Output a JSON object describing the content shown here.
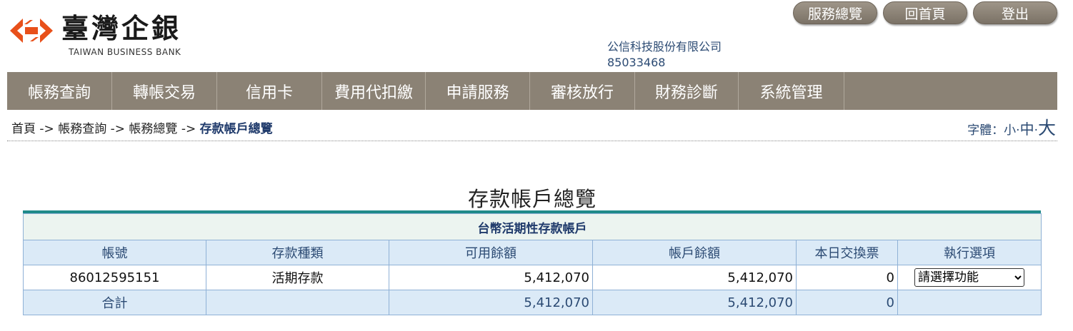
{
  "brand": {
    "name": "臺灣企銀",
    "subtitle": "TAIWAN BUSINESS BANK",
    "logo_color": "#e8501a"
  },
  "top_buttons": [
    "服務總覽",
    "回首頁",
    "登出"
  ],
  "company": {
    "name": "公信科技股份有限公司",
    "id": "85033468"
  },
  "menu": [
    "帳務查詢",
    "轉帳交易",
    "信用卡",
    "費用代扣繳",
    "申請服務",
    "審核放行",
    "財務診斷",
    "系統管理"
  ],
  "breadcrumb": {
    "items": [
      "首頁",
      "帳務查詢",
      "帳務總覽"
    ],
    "separator": "->",
    "current": "存款帳戶總覽"
  },
  "font_size": {
    "label": "字體：",
    "small": "小",
    "medium": "中",
    "large": "大",
    "dot": "·"
  },
  "page_title": "存款帳戶總覽",
  "table": {
    "section_title": "台幣活期性存款帳戶",
    "headers": [
      "帳號",
      "存款種類",
      "可用餘額",
      "帳戶餘額",
      "本日交換票",
      "執行選項"
    ],
    "row": {
      "account": "86012595151",
      "type": "活期存款",
      "available": "5,412,070",
      "balance": "5,412,070",
      "clearing": "0",
      "action_selected": "請選擇功能"
    },
    "total": {
      "label": "合計",
      "available": "5,412,070",
      "balance": "5,412,070",
      "clearing": "0"
    }
  }
}
